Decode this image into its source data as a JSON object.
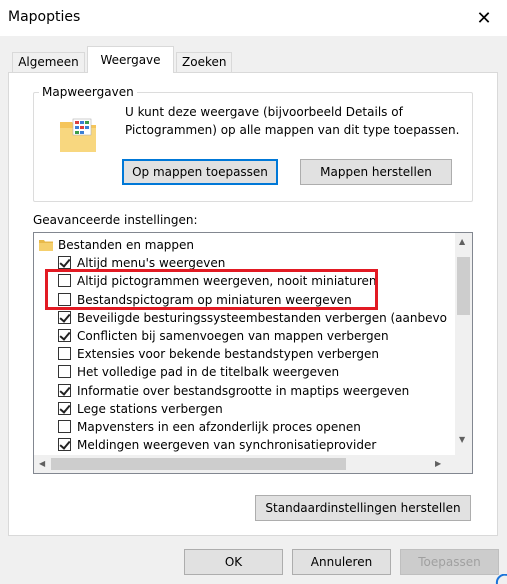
{
  "window": {
    "title": "Mapopties",
    "close_glyph": "✕"
  },
  "tabs": [
    {
      "label": "Algemeen"
    },
    {
      "label": "Weergave"
    },
    {
      "label": "Zoeken"
    }
  ],
  "active_tab": "Weergave",
  "folder_views": {
    "label": "Mapweergaven",
    "description": "U kunt deze weergave (bijvoorbeeld Details of Pictogrammen) op alle mappen van dit type toepassen.",
    "apply_button": "Op mappen toepassen",
    "reset_button": "Mappen herstellen"
  },
  "advanced": {
    "label": "Geavanceerde instellingen:",
    "root": "Bestanden en mappen",
    "items": [
      {
        "label": "Altijd menu's weergeven",
        "checked": true
      },
      {
        "label": "Altijd pictogrammen weergeven, nooit miniaturen",
        "checked": false
      },
      {
        "label": "Bestandspictogram op miniaturen weergeven",
        "checked": false
      },
      {
        "label": "Beveiligde besturingssysteembestanden verbergen (aanbevo",
        "checked": true
      },
      {
        "label": "Conflicten bij samenvoegen van mappen verbergen",
        "checked": true
      },
      {
        "label": "Extensies voor bekende bestandstypen verbergen",
        "checked": false
      },
      {
        "label": "Het volledige pad in de titelbalk weergeven",
        "checked": false
      },
      {
        "label": "Informatie over bestandsgrootte in maptips weergeven",
        "checked": true
      },
      {
        "label": "Lege stations verbergen",
        "checked": true
      },
      {
        "label": "Mapvensters in een afzonderlijk proces openen",
        "checked": false
      },
      {
        "label": "Meldingen weergeven van synchronisatieprovider",
        "checked": true
      }
    ],
    "restore_defaults_button": "Standaardinstellingen herstellen"
  },
  "footer": {
    "ok": "OK",
    "cancel": "Annuleren",
    "apply": "Toepassen"
  },
  "colors": {
    "highlight": "#e21a23",
    "focus_border": "#0078d7"
  }
}
